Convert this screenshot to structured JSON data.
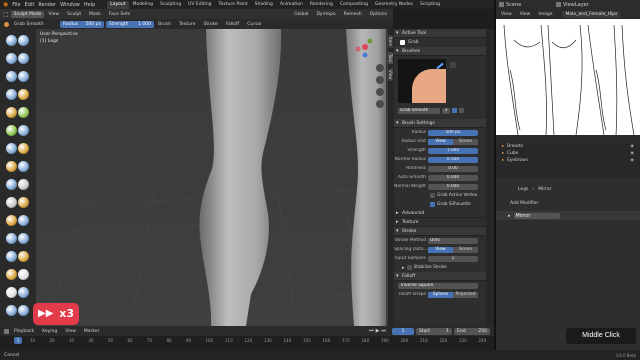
{
  "menu": {
    "items": [
      "File",
      "Edit",
      "Render",
      "Window",
      "Help"
    ]
  },
  "workspaces": {
    "tabs": [
      "Layout",
      "Modeling",
      "Sculpting",
      "UV Editing",
      "Texture Paint",
      "Shading",
      "Animation",
      "Rendering",
      "Compositing",
      "Geometry Nodes",
      "Scripting"
    ],
    "active": "Layout"
  },
  "scene": {
    "label": "Scene",
    "view_layer": "ViewLayer"
  },
  "viewport_header": {
    "mode": "Sculpt Mode",
    "items": [
      "View",
      "Sculpt",
      "Mask",
      "Face Sets"
    ],
    "extra": [
      "Global",
      "Dyntopo",
      "Remesh",
      "Options"
    ]
  },
  "tool_header": {
    "brush": "Grab Smooth",
    "radius_label": "Radius",
    "radius_value": "500 px",
    "strength_label": "Strength",
    "strength_value": "1.000",
    "dropdowns": [
      "Brush",
      "Texture",
      "Stroke",
      "Falloff",
      "Cursor"
    ]
  },
  "viewport": {
    "view_name": "User Perspective",
    "object_name": "(1) Legs",
    "sidebar_tabs": [
      "Item",
      "Tool",
      "View"
    ]
  },
  "props": {
    "active_tool": {
      "header": "Active Tool",
      "name": "Grab"
    },
    "brushes": {
      "header": "Brushes",
      "brush_name": "Grab Smooth",
      "users": "3"
    },
    "brush_settings": {
      "header": "Brush Settings",
      "radius": {
        "label": "Radius",
        "value": "500 px"
      },
      "radius_unit": {
        "label": "Radius Unit",
        "options": [
          "View",
          "Scene"
        ],
        "active": "View"
      },
      "strength": {
        "label": "Strength",
        "value": "1.000"
      },
      "normal_radius": {
        "label": "Normal Radius",
        "value": "0.500"
      },
      "hardness": {
        "label": "Hardness",
        "value": "0.00"
      },
      "auto_smooth": {
        "label": "Auto-Smooth",
        "value": "0.000"
      },
      "normal_weight": {
        "label": "Normal Weight",
        "value": "0.000"
      },
      "grab_active_vertex": "Grab Active Vertex",
      "grab_silhouette": "Grab Silhouette"
    },
    "advanced": "Advanced",
    "texture": "Texture",
    "stroke": {
      "header": "Stroke",
      "method": {
        "label": "Stroke Method",
        "value": "Dots"
      },
      "spacing": {
        "label": "Spacing Dista...",
        "options": [
          "View",
          "Scene"
        ],
        "active": "View"
      },
      "input_samples": {
        "label": "Input Samples",
        "value": "1"
      },
      "stabilize": "Stabilize Stroke"
    },
    "falloff": {
      "header": "Falloff",
      "preset": "Inverse Square",
      "shape": {
        "label": "Falloff Shape",
        "options": [
          "Sphere",
          "Projected"
        ],
        "active": "Sphere"
      }
    }
  },
  "image_editor": {
    "menu": [
      "View",
      "View",
      "Image"
    ],
    "image_name": "Male_and_Female_Hips"
  },
  "outliner": {
    "items": [
      "Breasts",
      "Cube",
      "Eyebrows"
    ]
  },
  "modifiers": {
    "breadcrumb_obj": "Legs",
    "breadcrumb_mod": "Mirror",
    "add_label": "Add Modifier",
    "modifier_name": "Mirror"
  },
  "timeline": {
    "menu": [
      "Playback",
      "Keying",
      "View",
      "Marker"
    ],
    "current_frame": "1",
    "start_label": "Start",
    "start": "1",
    "end_label": "End",
    "end": "250",
    "ticks": [
      "10",
      "20",
      "30",
      "40",
      "50",
      "60",
      "70",
      "80",
      "90",
      "100",
      "110",
      "120",
      "130",
      "140",
      "150",
      "160",
      "170",
      "180",
      "190",
      "200",
      "210",
      "220",
      "230",
      "240"
    ]
  },
  "status": {
    "left": "Cancel",
    "version": "3.6.0 Beta"
  },
  "overlay": {
    "speed_badge": "x3",
    "click_label": "Middle Click"
  },
  "colors": {
    "accent": "#4772b3",
    "badge": "#e23b4a",
    "active_orange": "#e8a03a"
  }
}
